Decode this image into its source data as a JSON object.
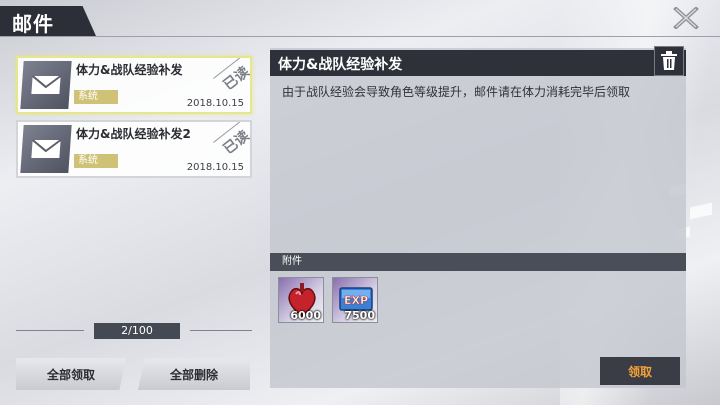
{
  "header": {
    "title": "邮件",
    "close_icon": "close-x-icon"
  },
  "mails": [
    {
      "title": "体力&战队经验补发",
      "tag": "系统",
      "date": "2018.10.15",
      "stamp": "已读",
      "selected": true
    },
    {
      "title": "体力&战队经验补发2",
      "tag": "系统",
      "date": "2018.10.15",
      "stamp": "已读",
      "selected": false
    }
  ],
  "pager": {
    "text": "2/100"
  },
  "buttons": {
    "claim_all": "全部领取",
    "delete_all": "全部删除",
    "claim": "领取"
  },
  "detail": {
    "title": "体力&战队经验补发",
    "body": "由于战队经验会导致角色等级提升，邮件请在体力消耗完毕后领取",
    "attachments_label": "附件",
    "attachments": [
      {
        "icon": "stamina-heart-icon",
        "count": "6000"
      },
      {
        "icon": "exp-icon",
        "count": "7500"
      }
    ]
  },
  "colors": {
    "accent": "#f2a13a",
    "dark": "#2e3139",
    "tag": "#cfc276",
    "selected_border": "#e5e68f"
  }
}
